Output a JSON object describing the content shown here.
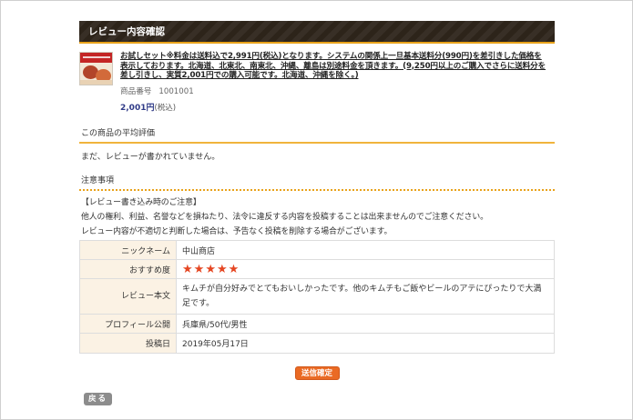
{
  "header": {
    "title": "レビュー内容確認"
  },
  "product": {
    "image": "product-thumbnail",
    "name": "お試しセット※料金は送料込で2,991円(税込)となります。システムの関係上一旦基本送料分(990円)を差引きした価格を表示しております。北海道、北東北、南東北、沖縄、離島は別途料金を頂きます。(9,250円以上のご購入でさらに送料分を差し引きし、実質2,001円での購入可能です。北海道、沖縄を除く。)",
    "code_label": "商品番号",
    "code": "1001001",
    "price": "2,001円",
    "tax": "(税込)"
  },
  "average": {
    "title": "この商品の平均評価",
    "message": "まだ、レビューが書かれていません。"
  },
  "notes": {
    "title": "注意事項",
    "lines": [
      "【レビュー書き込み時のご注意】",
      "他人の権利、利益、名誉などを損ねたり、法令に違反する内容を投稿することは出来ませんのでご注意ください。",
      "レビュー内容が不適切と判断した場合は、予告なく投稿を削除する場合がございます。"
    ]
  },
  "review": {
    "nickname_label": "ニックネーム",
    "nickname": "中山商店",
    "rating_label": "おすすめ度",
    "rating": 5,
    "star": "★",
    "body_label": "レビュー本文",
    "body": "キムチが自分好みでとてもおいしかったです。他のキムチもご飯やビールのアテにぴったりで大満足です。",
    "profile_label": "プロフィール公開",
    "profile": "兵庫県/50代/男性",
    "date_label": "投稿日",
    "date": "2019年05月17日"
  },
  "buttons": {
    "submit": "送信確定",
    "back": "戻る"
  },
  "colors": {
    "accent": "#e8a21a",
    "header_bg": "#2d241a",
    "star": "#e54622",
    "submit": "#ea6a24",
    "price": "#2f3a87"
  }
}
